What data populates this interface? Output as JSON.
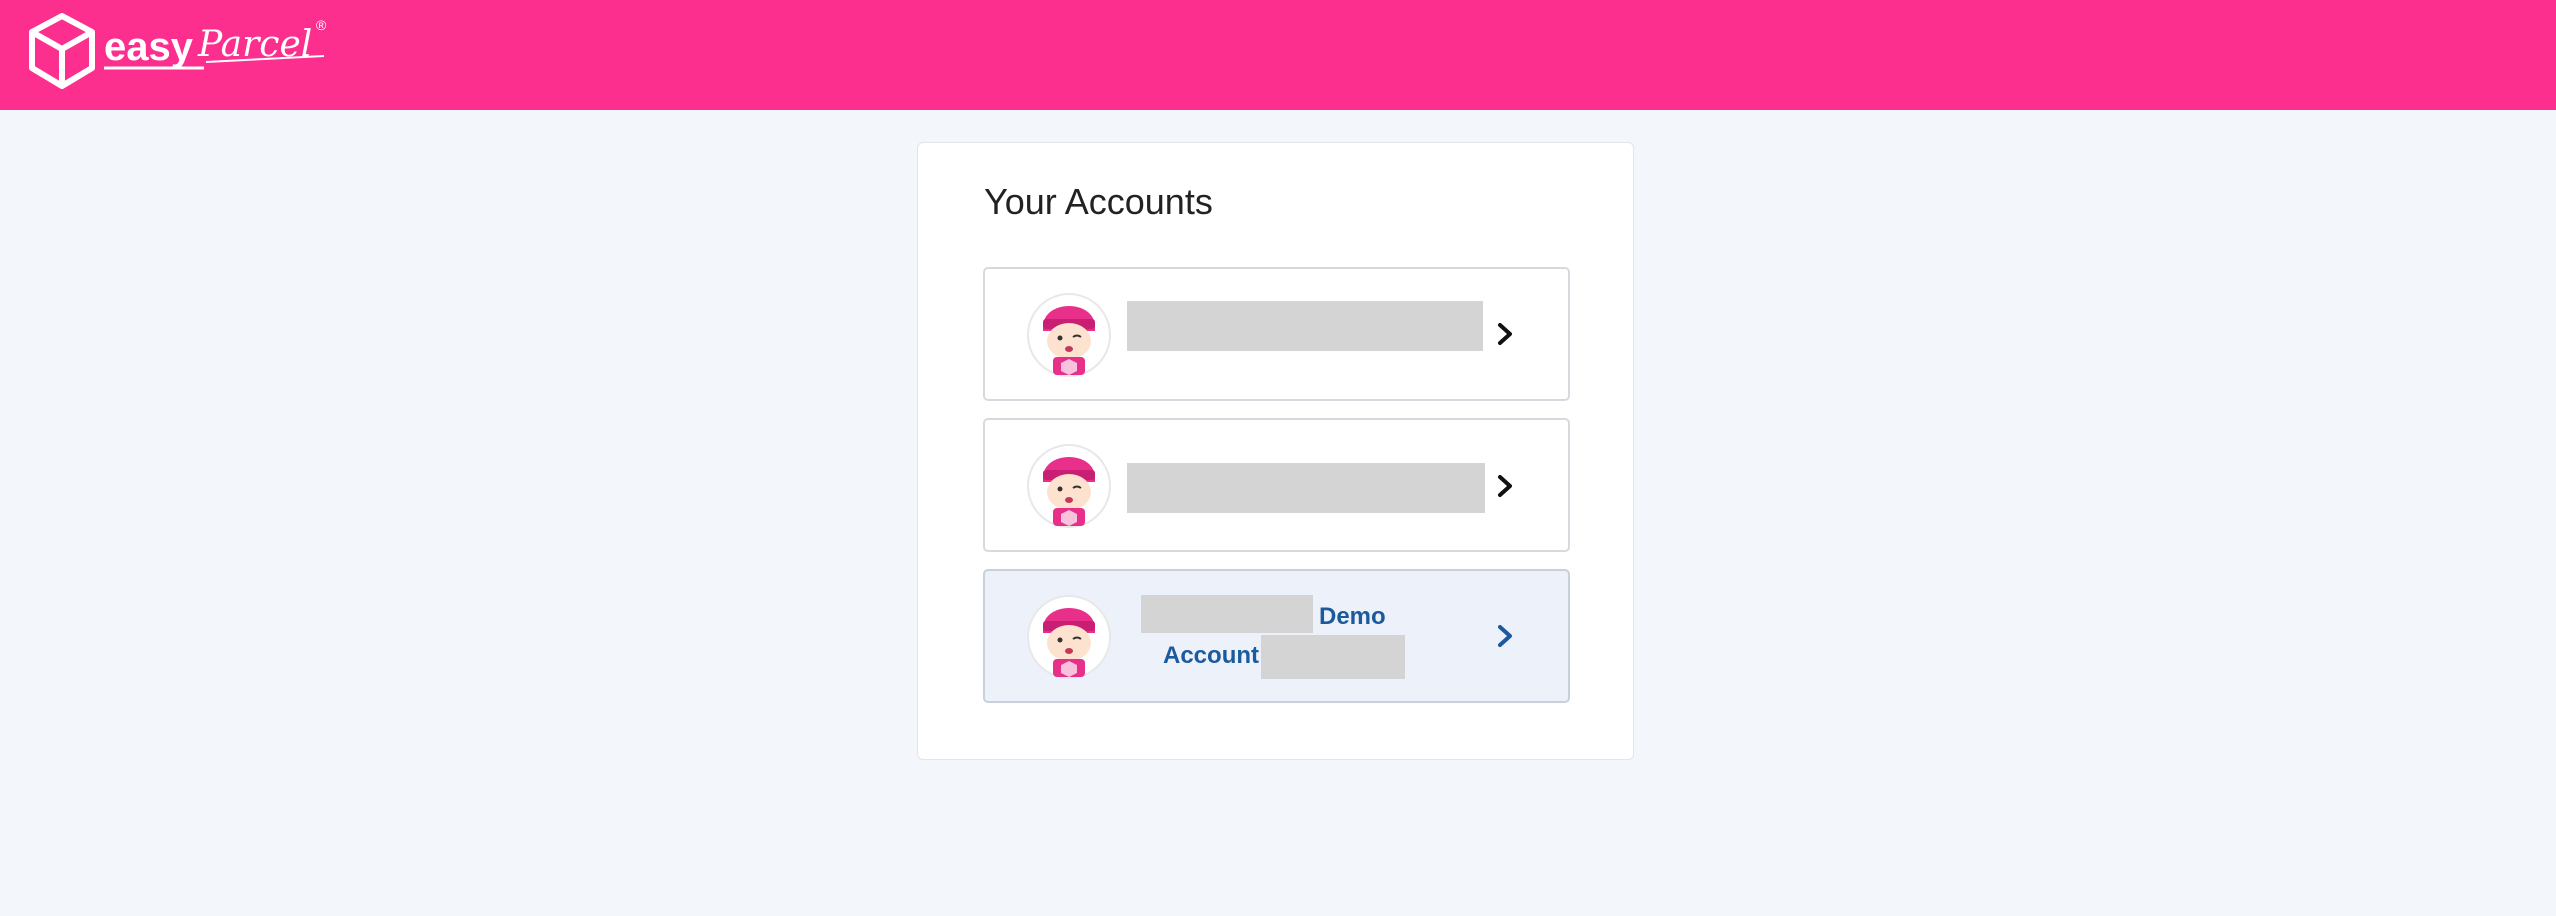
{
  "header": {
    "brand": "easyParcel",
    "brand_easy": "easy",
    "brand_parcel": "Parcel",
    "registered_mark": "®",
    "color": "#fc2f8f"
  },
  "page": {
    "title": "Your Accounts"
  },
  "accounts": [
    {
      "name": "",
      "redacted": true,
      "icon": "chevron-right-icon"
    },
    {
      "name": "",
      "redacted": true,
      "icon": "chevron-right-icon"
    },
    {
      "name_suffix_1": "Demo",
      "name_suffix_2": "Account",
      "redacted": true,
      "selected": true,
      "icon": "chevron-right-icon",
      "accent": "#1c5a9e"
    }
  ]
}
